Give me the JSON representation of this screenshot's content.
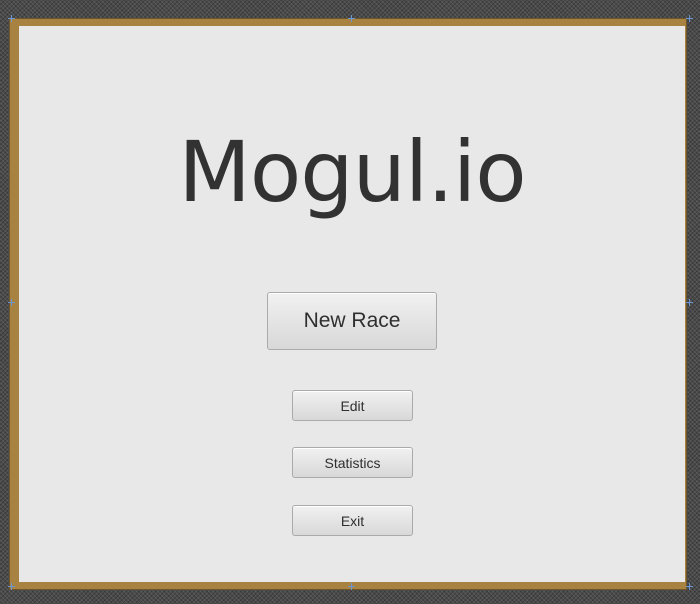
{
  "app": {
    "title": "Mogul.io"
  },
  "menu": {
    "new_race_label": "New Race",
    "edit_label": "Edit",
    "statistics_label": "Statistics",
    "exit_label": "Exit"
  },
  "colors": {
    "frame": "#a88240",
    "panel": "#e8e8e8",
    "title_text": "#323232",
    "handle": "#6a97d4"
  }
}
